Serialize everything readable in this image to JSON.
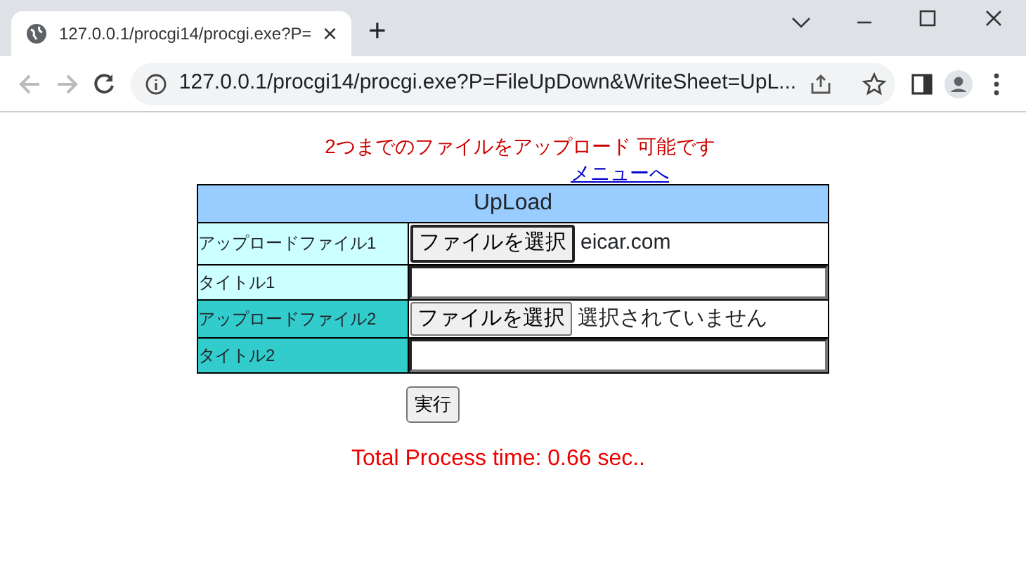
{
  "browser": {
    "tab_title": "127.0.0.1/procgi14/procgi.exe?P=",
    "tab_close": "×",
    "new_tab": "+",
    "address": "127.0.0.1/procgi14/procgi.exe?P=FileUpDown&WriteSheet=UpL..."
  },
  "page": {
    "notice": "2つまでのファイルをアップロード 可能です",
    "menu_link": "メニューへ",
    "form_title": "UpLoad",
    "rows": [
      {
        "kind": "file",
        "label": "アップロードファイル1",
        "color": "#ccffff",
        "button": "ファイルを選択",
        "file_name": "eicar.com"
      },
      {
        "kind": "text",
        "label": "タイトル1",
        "color": "#ccffff"
      },
      {
        "kind": "file",
        "label": "アップロードファイル2",
        "color": "#33cccc",
        "button": "ファイルを選択",
        "file_name": "選択されていません"
      },
      {
        "kind": "text",
        "label": "タイトル2",
        "color": "#33cccc"
      }
    ],
    "submit": "実行",
    "process_time": "Total Process time: 0.66 sec.."
  }
}
